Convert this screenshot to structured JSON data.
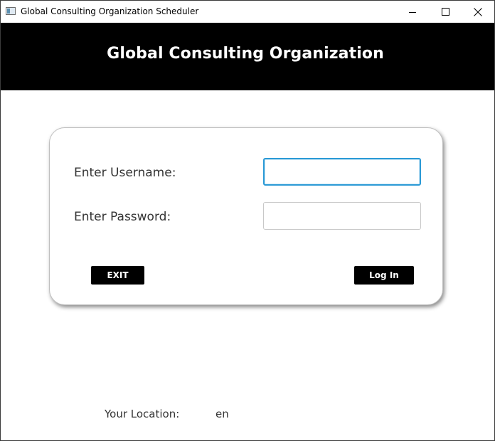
{
  "window": {
    "title": "Global Consulting Organization Scheduler",
    "icon": "app-window-icon",
    "controls": {
      "minimize_icon": "minimize-icon",
      "maximize_icon": "maximize-icon",
      "close_icon": "close-icon"
    }
  },
  "header": {
    "title": "Global Consulting Organization",
    "background_color": "#000000",
    "text_color": "#ffffff"
  },
  "login_form": {
    "username_label": "Enter Username:",
    "username_value": "",
    "password_label": "Enter Password:",
    "password_value": "",
    "exit_label": "EXIT",
    "login_label": "Log In",
    "focus_color": "#2c9ad6"
  },
  "footer": {
    "location_label": "Your Location:",
    "location_value": "en"
  }
}
